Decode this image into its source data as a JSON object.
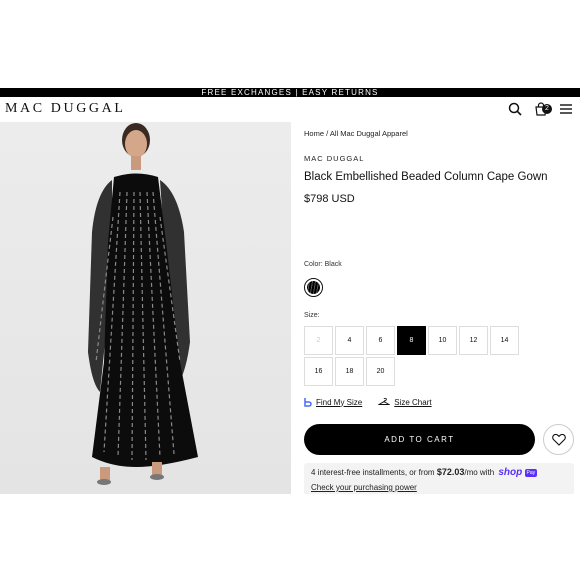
{
  "promo": {
    "text": "FREE EXCHANGES | EASY RETURNS"
  },
  "header": {
    "logo": "MAC DUGGAL",
    "cart_count": "2"
  },
  "hero": {
    "alt": "Model wearing black embellished beaded column cape gown"
  },
  "product": {
    "breadcrumb": "Home / All Mac Duggal Apparel",
    "brand": "MAC DUGGAL",
    "title": "Black Embellished Beaded Column Cape Gown",
    "price": "$798 USD",
    "color_label": "Color: Black",
    "size_label": "Size:",
    "sizes": [
      {
        "label": "2",
        "state": "disabled"
      },
      {
        "label": "4",
        "state": "available"
      },
      {
        "label": "6",
        "state": "available"
      },
      {
        "label": "8",
        "state": "selected"
      },
      {
        "label": "10",
        "state": "available"
      },
      {
        "label": "12",
        "state": "available"
      },
      {
        "label": "14",
        "state": "available"
      },
      {
        "label": "16",
        "state": "available"
      },
      {
        "label": "18",
        "state": "available"
      },
      {
        "label": "20",
        "state": "available"
      }
    ],
    "find_my_size": "Find My Size",
    "size_chart": "Size Chart",
    "add_to_cart": "ADD TO CART"
  },
  "installments": {
    "prefix": "4 interest-free installments, or from ",
    "amount": "$72.03",
    "suffix": "/mo with ",
    "shop": "shop",
    "pay": "Pay",
    "link": "Check your purchasing power"
  },
  "colors": {
    "accent": "#000000",
    "shop_pay": "#5a31f4"
  }
}
